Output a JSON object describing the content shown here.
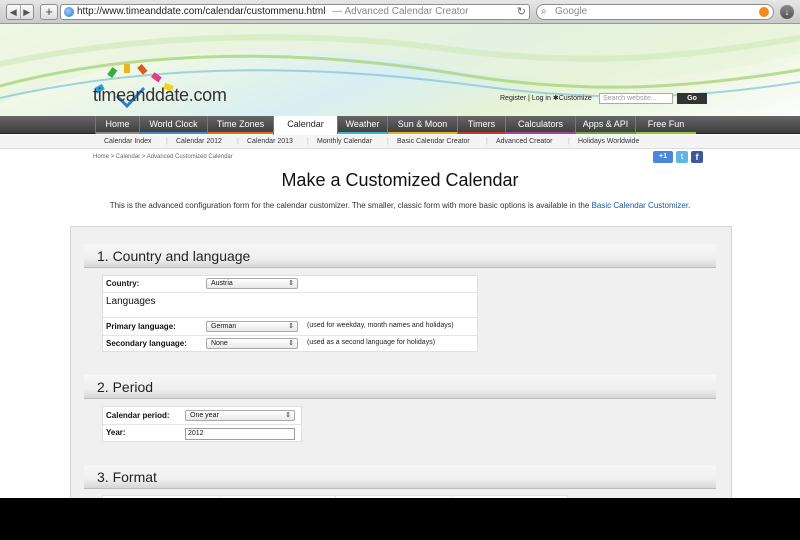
{
  "browser": {
    "url": "http://www.timeanddate.com/calendar/custommenu.html",
    "page_title": "— Advanced Calendar Creator",
    "search_placeholder": "Google",
    "back_glyph": "◀",
    "forward_glyph": "▶",
    "add_glyph": "+",
    "reload_glyph": "↻",
    "search_glyph": "⌕",
    "download_glyph": "↓"
  },
  "site": {
    "logo": "timeanddate.com",
    "user_links": {
      "register": "Register",
      "sep": "|",
      "login": "Log in",
      "customize": "Customize"
    },
    "search_placeholder": "Search website...",
    "go_label": "Go",
    "main_nav": [
      {
        "label": "Home",
        "color": "#8c8c8c"
      },
      {
        "label": "World Clock",
        "color": "#3d8fd1"
      },
      {
        "label": "Time Zones",
        "color": "#e46a1f"
      },
      {
        "label": "Calendar",
        "color": "#ffffff"
      },
      {
        "label": "Weather",
        "color": "#3bb3c9"
      },
      {
        "label": "Sun & Moon",
        "color": "#e3b021"
      },
      {
        "label": "Timers",
        "color": "#c0392b"
      },
      {
        "label": "Calculators",
        "color": "#b03c9b"
      },
      {
        "label": "Apps & API",
        "color": "#66a83c"
      },
      {
        "label": "Free Fun",
        "color": "#8cc63f"
      }
    ],
    "sub_nav": [
      "Calendar Index",
      "Calendar 2012",
      "Calendar 2013",
      "Monthly Calendar",
      "Basic Calendar Creator",
      "Advanced Creator",
      "Holidays Worldwide"
    ],
    "breadcrumb": "Home > Calendar > Advanced Customized Calendar",
    "social": {
      "gplus": "+1",
      "twitter": "t",
      "facebook": "f"
    }
  },
  "content": {
    "title": "Make a Customized Calendar",
    "intro_text": "This is the advanced configuration form for the calendar customizer. The smaller, classic form with more basic options is available in the",
    "intro_link": "Basic Calendar Customizer",
    "intro_end": "."
  },
  "form": {
    "section1": {
      "heading": "1. Country and language",
      "country_label": "Country:",
      "country_value": "Austria",
      "languages_heading": "Languages",
      "primary_label": "Primary language:",
      "primary_value": "German",
      "primary_note": "(used for weekday, month names and holidays)",
      "secondary_label": "Secondary language:",
      "secondary_value": "None",
      "secondary_note": "(used as a second language for holidays)"
    },
    "section2": {
      "heading": "2. Period",
      "period_label": "Calendar period:",
      "period_value": "One year",
      "year_label": "Year:",
      "year_value": "2012"
    },
    "section3": {
      "heading": "3. Format"
    },
    "select_arrow": "⇕"
  }
}
